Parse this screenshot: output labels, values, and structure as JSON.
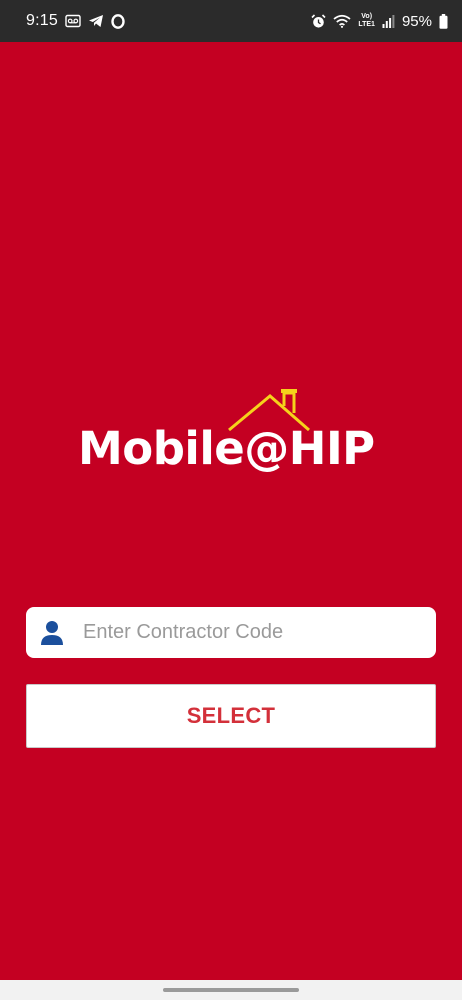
{
  "status_bar": {
    "time": "9:15",
    "battery_percent": "95%",
    "volte_label": "Vo)",
    "lte_label": "LTE1",
    "left_icons": [
      "voicemail-icon",
      "telegram-icon",
      "opera-icon"
    ],
    "right_icons": [
      "alarm-icon",
      "wifi-icon",
      "volte-icon",
      "signal-icon",
      "battery-icon"
    ]
  },
  "logo": {
    "text": "Mobile@HIP",
    "roof_color": "#f5d21b"
  },
  "login": {
    "contractor_placeholder": "Enter Contractor Code",
    "contractor_value": "",
    "select_label": "SELECT"
  },
  "colors": {
    "background": "#c40022",
    "button_text": "#d3303a",
    "user_icon": "#1b4f9c"
  }
}
